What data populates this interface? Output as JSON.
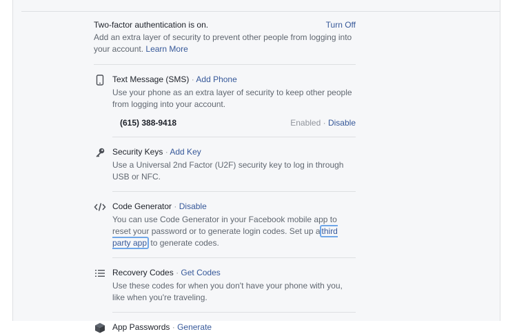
{
  "two_factor": {
    "status_text": "Two-factor authentication is on.",
    "turn_off_label": "Turn Off",
    "description": "Add an extra layer of security to prevent other people from logging into your account.",
    "learn_more_label": "Learn More"
  },
  "methods": {
    "sms": {
      "title": "Text Message (SMS)",
      "action_label": "Add Phone",
      "description": "Use your phone as an extra layer of security to keep other people from logging into your account.",
      "phone_number": "(615) 388-9418",
      "status": "Enabled",
      "disable_label": "Disable",
      "icon": "phone-icon"
    },
    "security_keys": {
      "title": "Security Keys",
      "action_label": "Add Key",
      "description": "Use a Universal 2nd Factor (U2F) security key to log in through USB or NFC.",
      "icon": "key-icon"
    },
    "code_generator": {
      "title": "Code Generator",
      "action_label": "Disable",
      "description_before": "You can use Code Generator in your Facebook mobile app to reset your password or to generate login codes. Set up a",
      "third_party_label": "third party app",
      "description_after": "to generate codes.",
      "icon": "code-icon"
    },
    "recovery_codes": {
      "title": "Recovery Codes",
      "action_label": "Get Codes",
      "description": "Use these codes for when you don't have your phone with you, like when you're traveling.",
      "icon": "list-icon"
    },
    "app_passwords": {
      "title": "App Passwords",
      "action_label": "Generate",
      "icon": "cube-icon"
    }
  },
  "separator_dot": "·"
}
